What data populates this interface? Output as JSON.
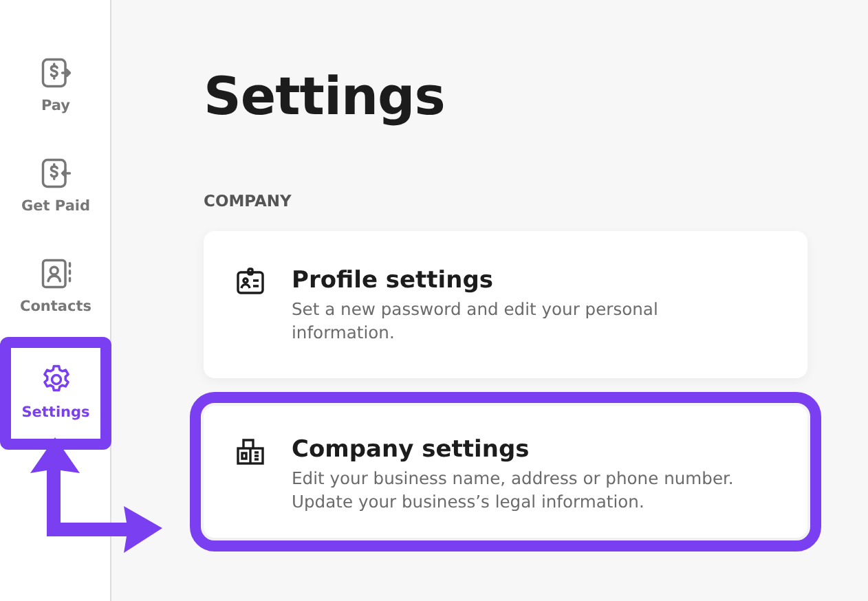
{
  "sidebar": {
    "items": [
      {
        "label": "Pay",
        "kind": "pay",
        "selected": false,
        "highlighted": false
      },
      {
        "label": "Get Paid",
        "kind": "get-paid",
        "selected": false,
        "highlighted": false
      },
      {
        "label": "Contacts",
        "kind": "contacts",
        "selected": false,
        "highlighted": false
      },
      {
        "label": "Settings",
        "kind": "settings",
        "selected": true,
        "highlighted": true
      }
    ]
  },
  "title": "Settings",
  "section": "COMPANY",
  "cards": [
    {
      "kind": "profile",
      "title": "Profile settings",
      "description": "Set a new password and edit your personal information.",
      "highlighted": false
    },
    {
      "kind": "company",
      "title": "Company settings",
      "description": "Edit your business name, address or phone number. Update your business’s legal information.",
      "highlighted": true
    }
  ],
  "annotations": [
    {
      "kind": "elbow-arrow"
    }
  ]
}
